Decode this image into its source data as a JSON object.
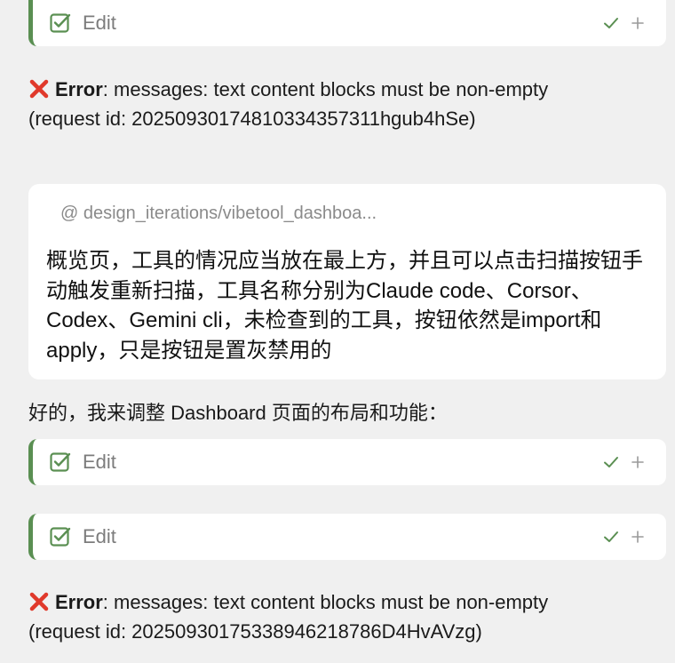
{
  "edit_cards": [
    {
      "label": "Edit",
      "accept_icon": "checkmark-icon",
      "more_icon": "plus-icon"
    },
    {
      "label": "Edit",
      "accept_icon": "checkmark-icon",
      "more_icon": "plus-icon"
    },
    {
      "label": "Edit",
      "accept_icon": "checkmark-icon",
      "more_icon": "plus-icon"
    }
  ],
  "errors": [
    {
      "label": "Error",
      "message": ": messages: text content blocks must be non-empty",
      "request": "(request id: 20250930174810334357311hgub4hSe)"
    },
    {
      "label": "Error",
      "message": ": messages: text content blocks must be non-empty",
      "request": "(request id: 20250930175338946218786D4HvAVzg)"
    }
  ],
  "user_message": {
    "mention": "@ design_iterations/vibetool_dashboa...",
    "text": "概览页，工具的情况应当放在最上方，并且可以点击扫描按钮手动触发重新扫描，工具名称分别为Claude code、Corsor、Codex、Gemini cli，未检查到的工具，按钮依然是import和apply，只是按钮是置灰禁用的"
  },
  "assistant_reply": "好的，我来调整 Dashboard 页面的布局和功能：",
  "colors": {
    "background": "#f0f0f0",
    "card": "#ffffff",
    "accent_green": "#5a8f52",
    "error_red": "#e0392b",
    "muted_text": "#7c7c7c"
  }
}
